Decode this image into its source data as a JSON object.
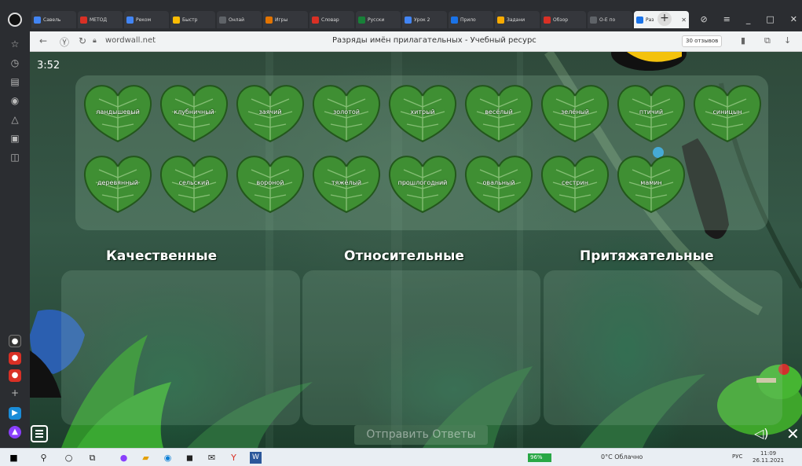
{
  "browser": {
    "tabs": [
      {
        "label": "Савель",
        "color": "#4285f4"
      },
      {
        "label": "МЕТОД",
        "color": "#d93025"
      },
      {
        "label": "Реком",
        "color": "#4285f4"
      },
      {
        "label": "Быстр",
        "color": "#fbbc04"
      },
      {
        "label": "Онлай",
        "color": "#5f6368"
      },
      {
        "label": "Игры",
        "color": "#e37400"
      },
      {
        "label": "Словар",
        "color": "#d93025"
      },
      {
        "label": "Русски",
        "color": "#188038"
      },
      {
        "label": "Урок 2",
        "color": "#4285f4"
      },
      {
        "label": "Прило",
        "color": "#1a73e8"
      },
      {
        "label": "Задани",
        "color": "#f9ab00"
      },
      {
        "label": "Обзор",
        "color": "#d93025"
      },
      {
        "label": "О-Е по",
        "color": "#5f6368"
      },
      {
        "label": "Раз",
        "color": "#1a73e8",
        "active": true
      }
    ],
    "url": "wordwall.net",
    "page_title": "Разряды имён прилагательных - Учебный ресурс",
    "reviews": "30 отзывов"
  },
  "game": {
    "timer": "3:52",
    "words_row1": [
      "ландышевый",
      "клубничный",
      "заячий",
      "золотой",
      "хитрый",
      "весёлый",
      "зелёный",
      "птичий",
      "синицын"
    ],
    "words_row2": [
      "деревянный",
      "сельский",
      "вороной",
      "тяжёлый",
      "прошлогодний",
      "овальный",
      "сестрин",
      "мамин"
    ],
    "categories": [
      "Качественные",
      "Относительные",
      "Притяжательные"
    ],
    "submit_label": "Отправить Ответы"
  },
  "taskbar": {
    "battery": "96%",
    "weather": "0°C  Облачно",
    "lang": "РУС",
    "time": "11:09",
    "date": "26.11.2021"
  },
  "colors": {
    "leaf": "#3f8f33",
    "leaf_dark": "#23571c",
    "bank_panel": "rgba(160,205,175,0.22)",
    "browser_chrome": "#2b2d31"
  },
  "icons": [
    "profile-icon",
    "back-icon",
    "forward-icon",
    "reload-icon",
    "lock-icon",
    "bookmark-icon",
    "download-icon",
    "menu-icon",
    "sound-icon",
    "close-icon",
    "windows-start-icon",
    "search-icon"
  ]
}
